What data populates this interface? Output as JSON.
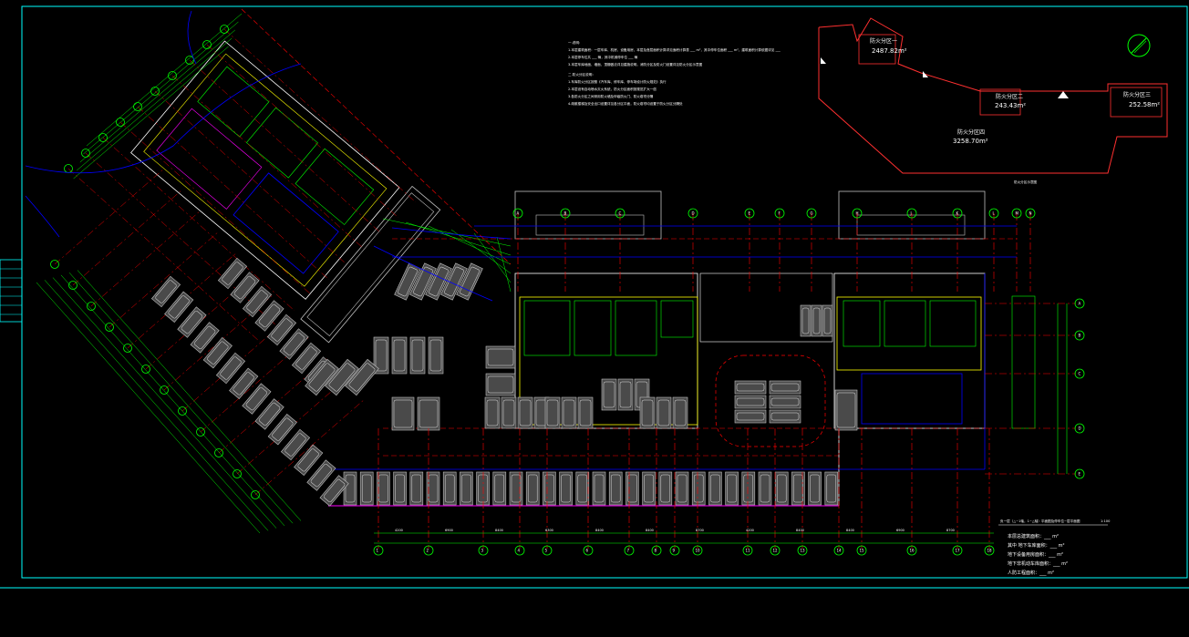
{
  "drawing": {
    "title": "负一层（△~1轴，1~△轴）平面图及停车位~层平面图",
    "scale": "1:100",
    "notes_heading": "一.说明：",
    "notes": [
      "1.本层建筑面积：一层车库、机房、设备用房，本层及首层面积计算详见面积计算表 ___ m²，其中停车位面积 ___ m²，建筑面积计算依据详见 ___",
      "2.本层停车位共 ___ 辆，其中机械停车位 ___ 辆",
      "3.本层车库地面、墙面、顶棚做法详见建施说明，消防分区及防火门设置详见防火分区示意图",
      "二.防火分区说明：",
      "1.车库防火分区按照《汽车库、修车库、停车场设计防火规范》执行",
      "2.本层设有自动喷水灭火系统，防火分区面积按规范扩大一倍",
      "3.各防火分区之间采用防火墙及甲级防火门、防火卷帘分隔",
      "4.疏散楼梯及安全出口设置详见各分区平面，防火卷帘均设置于防火分区分隔处"
    ],
    "stats": [
      "本层总建筑面积：___ m²",
      "其中 地下车库面积：___ m²",
      "地下设备用房面积：___ m²",
      "地下非机动车库面积：___ m²",
      "人防工程面积：___ m²"
    ],
    "keyplan": {
      "zones": [
        {
          "label": "防火分区一",
          "area": "2487.82m²"
        },
        {
          "label": "防火分区二",
          "area": "243.43m²"
        },
        {
          "label": "防火分区三",
          "area": "252.58m²"
        },
        {
          "label": "防火分区四",
          "area": "3258.70m²"
        }
      ]
    },
    "side_label": "防火分区示意图",
    "axis_top": [
      "A",
      "B",
      "C",
      "D",
      "E",
      "F",
      "G",
      "H",
      "J",
      "K",
      "L",
      "M",
      "N"
    ],
    "axis_bottom": [
      "1",
      "2",
      "3",
      "4",
      "5",
      "6",
      "7",
      "8",
      "9",
      "10",
      "11",
      "12",
      "13",
      "14",
      "15",
      "16",
      "17",
      "18"
    ],
    "axis_right": [
      "A",
      "B",
      "C",
      "D",
      "E"
    ],
    "dims_bottom": [
      "4200",
      "6900",
      "8400",
      "6300",
      "8400",
      "8400",
      "8700",
      "4200",
      "8400",
      "8400",
      "6900",
      "8700"
    ]
  },
  "colors": {
    "background": "#000000",
    "frame": "#00ffff",
    "axis": "#ff0000",
    "dimension": "#00ff00",
    "wall": "#ffffff",
    "parking": "#c0c0c0",
    "fire": "#0000ff",
    "magenta": "#ff00ff",
    "yellow": "#ffff00",
    "keyplan": "#ff3030"
  },
  "icons": {
    "north_arrow": "north-arrow-icon",
    "crosshair": "crosshair-icon"
  }
}
